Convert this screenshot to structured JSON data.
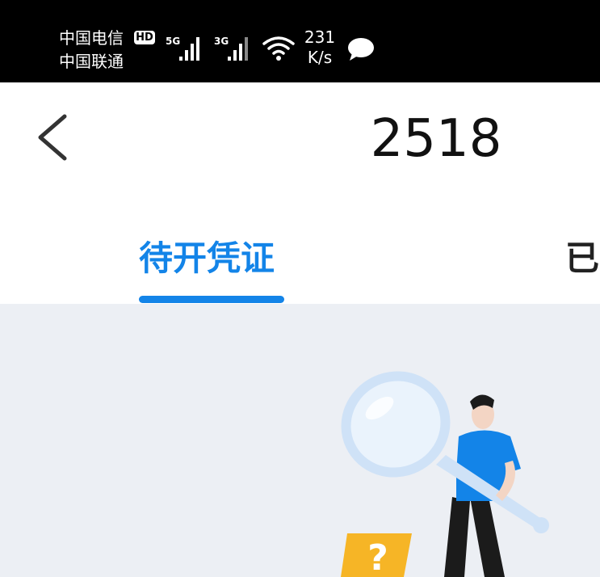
{
  "status_bar": {
    "carrier_1": "中国电信",
    "hd_badge": "HD",
    "carrier_2": "中国联通",
    "network_1": "5G",
    "network_2": "3G",
    "speed_value": "231",
    "speed_unit": "K/s",
    "icons": [
      "signal-icon",
      "signal-icon",
      "wifi-icon",
      "message-bubble-icon"
    ]
  },
  "header": {
    "back_icon": "chevron-left-icon",
    "title": "2518"
  },
  "tabs": [
    {
      "label": "待开凭证",
      "active": true
    },
    {
      "label": "已",
      "active": false
    }
  ],
  "empty_state": {
    "illustration": "person-with-magnifying-glass-illustration",
    "accent_color": "#1384e8"
  },
  "colors": {
    "accent": "#1384e8",
    "content_background": "#eceff4"
  }
}
